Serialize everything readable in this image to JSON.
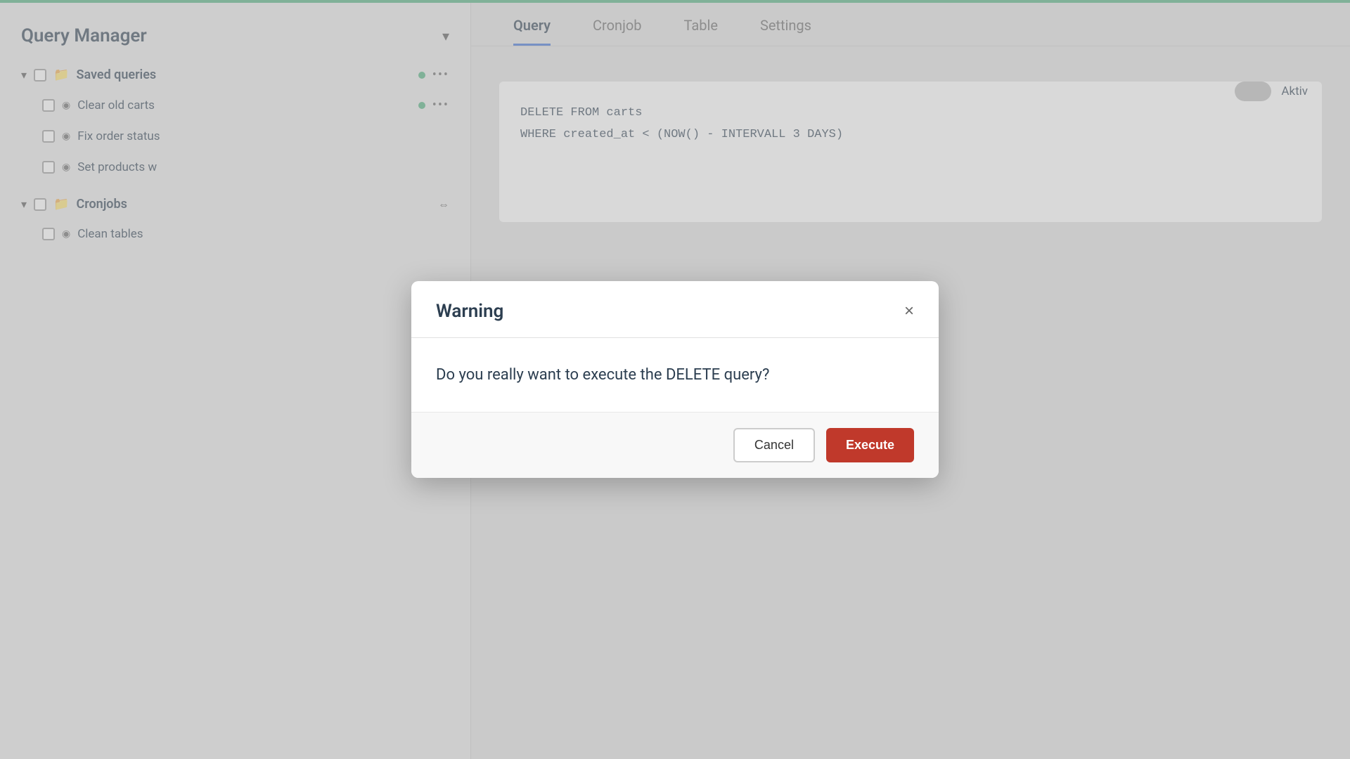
{
  "topBar": {
    "color": "#4caf7d"
  },
  "sidebar": {
    "title": "Query Manager",
    "chevron": "▾",
    "savedQueries": {
      "label": "Saved queries",
      "items": [
        {
          "name": "Clear old carts"
        },
        {
          "name": "Fix order status"
        },
        {
          "name": "Set products w"
        }
      ]
    },
    "cronjobs": {
      "label": "Cronjobs",
      "items": [
        {
          "name": "Clean tables"
        }
      ]
    }
  },
  "tabs": {
    "items": [
      "Query",
      "Cronjob",
      "Table",
      "Settings"
    ],
    "active": "Query"
  },
  "editor": {
    "line1": "DELETE FROM carts",
    "line2": "WHERE created_at < (NOW() - INTERVALL 3 DAYS)"
  },
  "toggle": {
    "label": "Aktiv"
  },
  "dialog": {
    "title": "Warning",
    "message": "Do you really want to execute the DELETE query?",
    "cancel_label": "Cancel",
    "execute_label": "Execute",
    "close_symbol": "×"
  }
}
